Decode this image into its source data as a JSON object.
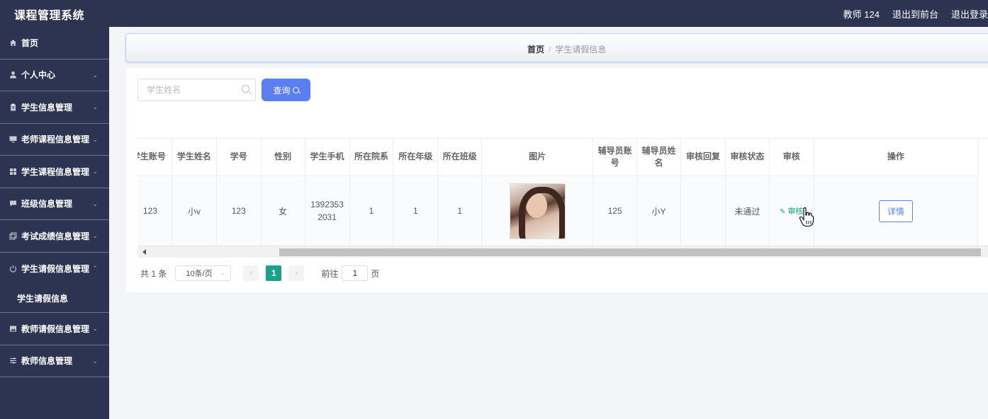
{
  "header": {
    "app_title": "课程管理系统",
    "user_label": "教师 124",
    "to_frontend": "退出到前台",
    "logout": "退出登录"
  },
  "sidebar": {
    "items": [
      {
        "label": "首页",
        "icon": "home-icon",
        "has_arrow": false
      },
      {
        "label": "个人中心",
        "icon": "user-icon",
        "has_arrow": true
      },
      {
        "label": "学生信息管理",
        "icon": "clipboard-icon",
        "has_arrow": true
      },
      {
        "label": "老师课程信息管理",
        "icon": "monitor-icon",
        "has_arrow": true
      },
      {
        "label": "学生课程信息管理",
        "icon": "grid-icon",
        "has_arrow": true
      },
      {
        "label": "班级信息管理",
        "icon": "chat-icon",
        "has_arrow": true
      },
      {
        "label": "考试成绩信息管理",
        "icon": "copy-icon",
        "has_arrow": true
      },
      {
        "label": "学生请假信息管理",
        "icon": "power-icon",
        "has_arrow": true,
        "expanded": true
      },
      {
        "label": "教师请假信息管理",
        "icon": "image-icon",
        "has_arrow": true
      },
      {
        "label": "教师信息管理",
        "icon": "sliders-icon",
        "has_arrow": true
      }
    ],
    "subitem": "学生请假信息"
  },
  "breadcrumb": {
    "home": "首页",
    "separator": "/",
    "current": "学生请假信息"
  },
  "search": {
    "placeholder": "学生姓名",
    "button_label": "查询"
  },
  "table": {
    "columns": [
      "学生账号",
      "学生姓名",
      "学号",
      "性别",
      "学生手机",
      "所在院系",
      "所在年级",
      "所在班级",
      "图片",
      "辅导员账号",
      "辅导员姓名",
      "审核回复",
      "审核状态",
      "审核",
      "操作"
    ],
    "rows": [
      {
        "student_account": "123",
        "student_name": "小v",
        "student_id": "123",
        "gender": "女",
        "phone": "13923532031",
        "department": "1",
        "grade": "1",
        "class": "1",
        "counselor_account": "125",
        "counselor_name": "小Y",
        "review_reply": "",
        "review_status": "未通过",
        "review_action": "审核",
        "detail_button": "详情"
      }
    ]
  },
  "pagination": {
    "total": "共 1 条",
    "page_size": "10条/页",
    "current_page": "1",
    "jump_label": "前往",
    "jump_value": "1",
    "page_suffix": "页"
  },
  "colors": {
    "sidebar_bg": "#2d3452",
    "primary": "#5b7ff3",
    "page_active": "#19a28b",
    "review_link": "#16a37a"
  }
}
